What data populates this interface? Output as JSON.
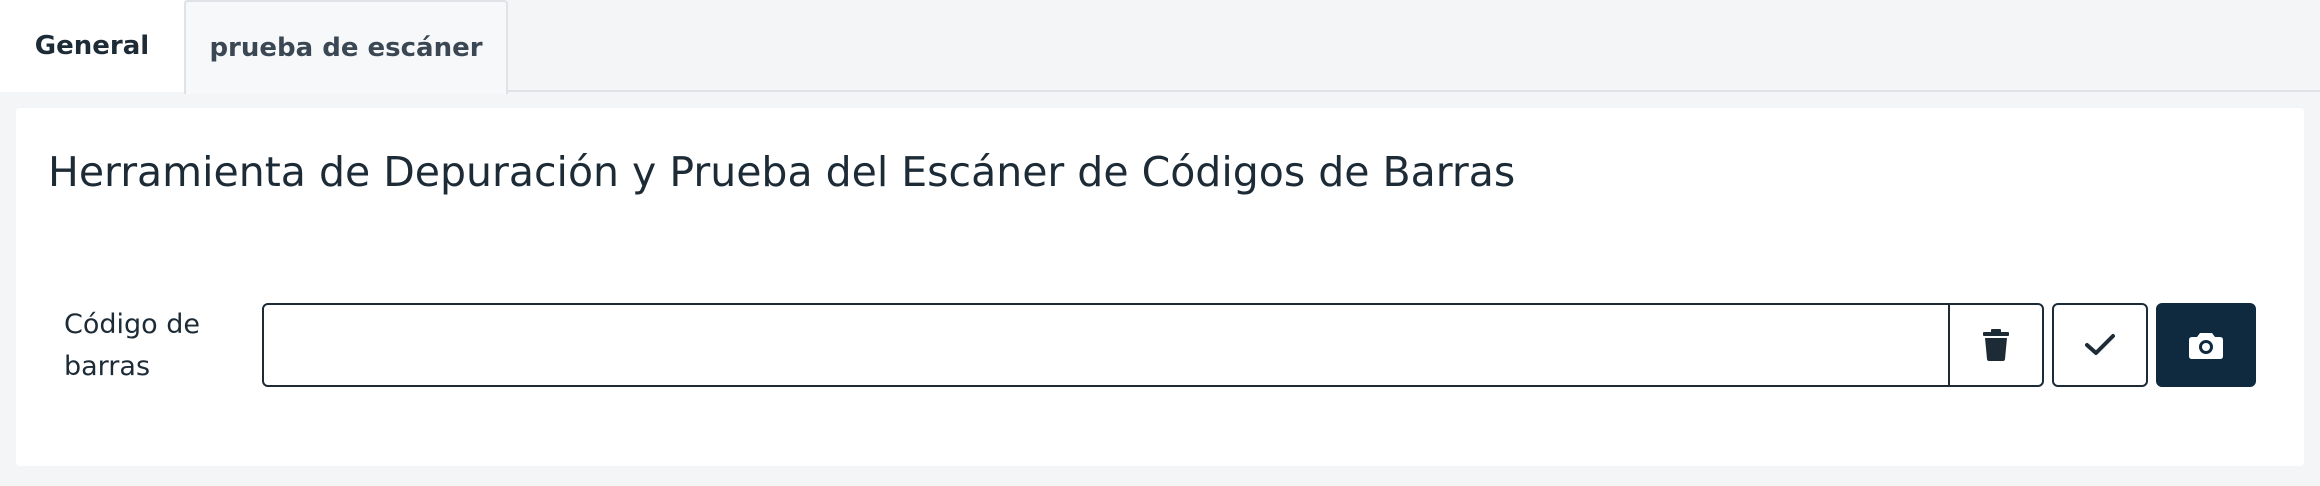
{
  "tabs": [
    {
      "label": "General"
    },
    {
      "label": "prueba de escáner"
    }
  ],
  "main": {
    "title": "Herramienta de Depuración y Prueba del Escáner de Códigos de Barras",
    "barcode_field": {
      "label": "Código de barras",
      "value": "",
      "placeholder": ""
    },
    "buttons": {
      "clear_icon": "trash-icon",
      "confirm_icon": "check-icon",
      "camera_icon": "camera-icon"
    }
  },
  "colors": {
    "primary": "#0f2a3f",
    "text": "#1d2b36",
    "background": "#f3f5f7",
    "card": "#ffffff"
  }
}
